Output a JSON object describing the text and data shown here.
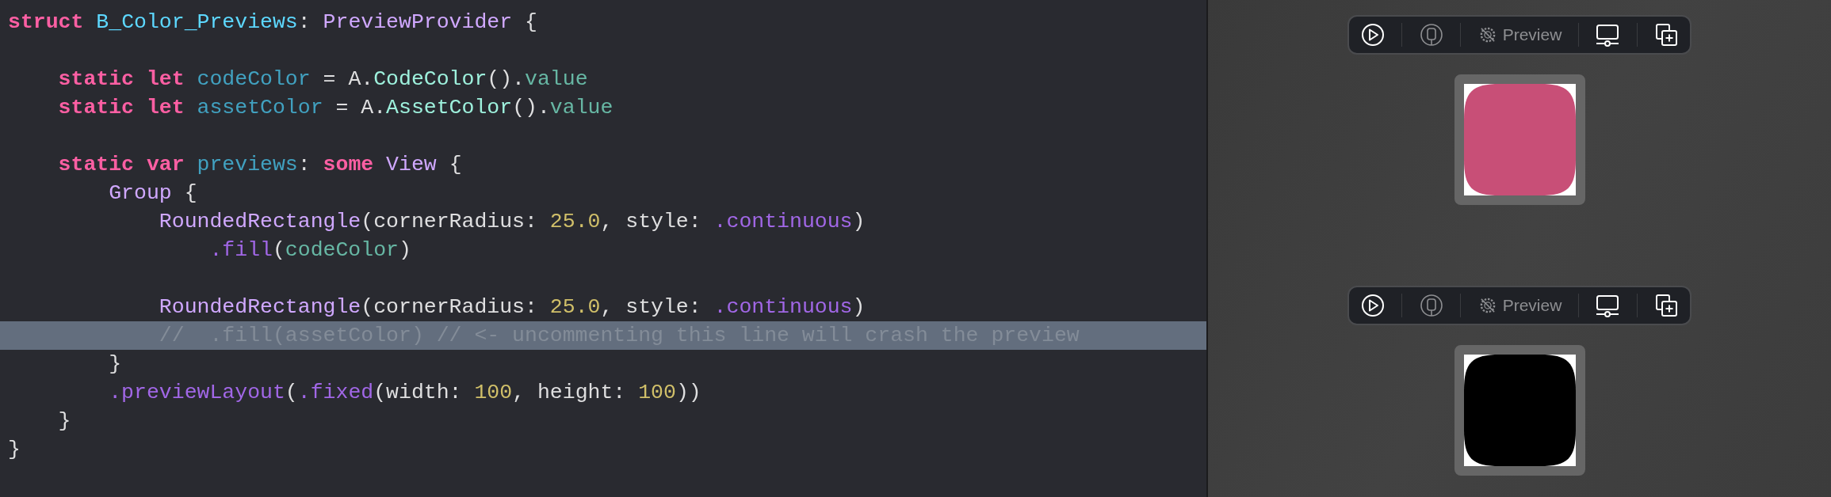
{
  "editor": {
    "lines": [
      {
        "kind": "code",
        "highlighted": false,
        "tokens": [
          {
            "kind": "keyword",
            "text": "struct "
          },
          {
            "kind": "type-decl",
            "text": "B_Color_Previews"
          },
          {
            "kind": "plain",
            "text": ": "
          },
          {
            "kind": "type",
            "text": "PreviewProvider"
          },
          {
            "kind": "plain",
            "text": " {"
          }
        ],
        "children": [
          {
            "kind": "blank",
            "highlighted": false
          },
          {
            "kind": "code",
            "highlighted": false,
            "tokens": [
              {
                "kind": "keyword",
                "text": "static let "
              },
              {
                "kind": "decl",
                "text": "codeColor"
              },
              {
                "kind": "plain",
                "text": " = A."
              },
              {
                "kind": "project-type",
                "text": "CodeColor"
              },
              {
                "kind": "plain",
                "text": "()."
              },
              {
                "kind": "project-member",
                "text": "value"
              }
            ]
          },
          {
            "kind": "code",
            "highlighted": false,
            "tokens": [
              {
                "kind": "keyword",
                "text": "static let "
              },
              {
                "kind": "decl",
                "text": "assetColor"
              },
              {
                "kind": "plain",
                "text": " = A."
              },
              {
                "kind": "project-type",
                "text": "AssetColor"
              },
              {
                "kind": "plain",
                "text": "()."
              },
              {
                "kind": "project-member",
                "text": "value"
              }
            ]
          },
          {
            "kind": "blank",
            "highlighted": false
          },
          {
            "kind": "code",
            "highlighted": false,
            "tokens": [
              {
                "kind": "keyword",
                "text": "static var "
              },
              {
                "kind": "decl",
                "text": "previews"
              },
              {
                "kind": "plain",
                "text": ": "
              },
              {
                "kind": "keyword",
                "text": "some "
              },
              {
                "kind": "type",
                "text": "View"
              },
              {
                "kind": "plain",
                "text": " {"
              }
            ],
            "children": [
              {
                "kind": "code",
                "highlighted": false,
                "tokens": [
                  {
                    "kind": "type",
                    "text": "Group"
                  },
                  {
                    "kind": "plain",
                    "text": " {"
                  }
                ],
                "children": [
                  {
                    "kind": "code",
                    "highlighted": false,
                    "tokens": [
                      {
                        "kind": "type",
                        "text": "RoundedRectangle"
                      },
                      {
                        "kind": "plain",
                        "text": "(cornerRadius: "
                      },
                      {
                        "kind": "number",
                        "text": "25.0"
                      },
                      {
                        "kind": "plain",
                        "text": ", style: "
                      },
                      {
                        "kind": "member",
                        "text": ".continuous"
                      },
                      {
                        "kind": "plain",
                        "text": ")"
                      }
                    ],
                    "children": [
                      {
                        "kind": "code",
                        "highlighted": false,
                        "tokens": [
                          {
                            "kind": "member",
                            "text": ".fill"
                          },
                          {
                            "kind": "plain",
                            "text": "("
                          },
                          {
                            "kind": "project-member",
                            "text": "codeColor"
                          },
                          {
                            "kind": "plain",
                            "text": ")"
                          }
                        ]
                      }
                    ]
                  },
                  {
                    "kind": "blank",
                    "highlighted": false
                  },
                  {
                    "kind": "code",
                    "highlighted": false,
                    "tokens": [
                      {
                        "kind": "type",
                        "text": "RoundedRectangle"
                      },
                      {
                        "kind": "plain",
                        "text": "(cornerRadius: "
                      },
                      {
                        "kind": "number",
                        "text": "25.0"
                      },
                      {
                        "kind": "plain",
                        "text": ", style: "
                      },
                      {
                        "kind": "member",
                        "text": ".continuous"
                      },
                      {
                        "kind": "plain",
                        "text": ")"
                      }
                    ]
                  },
                  {
                    "kind": "code",
                    "highlighted": true,
                    "tokens": [
                      {
                        "kind": "comment",
                        "text": "//  .fill(assetColor) // <- uncommenting this line will crash the preview"
                      }
                    ]
                  }
                ]
              },
              {
                "kind": "code",
                "highlighted": false,
                "tokens": [
                  {
                    "kind": "plain",
                    "text": "}"
                  }
                ]
              },
              {
                "kind": "code",
                "highlighted": false,
                "tokens": [
                  {
                    "kind": "member",
                    "text": ".previewLayout"
                  },
                  {
                    "kind": "plain",
                    "text": "("
                  },
                  {
                    "kind": "member",
                    "text": ".fixed"
                  },
                  {
                    "kind": "plain",
                    "text": "(width: "
                  },
                  {
                    "kind": "number",
                    "text": "100"
                  },
                  {
                    "kind": "plain",
                    "text": ", height: "
                  },
                  {
                    "kind": "number",
                    "text": "100"
                  },
                  {
                    "kind": "plain",
                    "text": "))"
                  }
                ]
              }
            ]
          },
          {
            "kind": "code",
            "highlighted": false,
            "tokens": [
              {
                "kind": "plain",
                "text": "}"
              }
            ]
          }
        ]
      },
      {
        "kind": "code",
        "highlighted": false,
        "tokens": [
          {
            "kind": "plain",
            "text": "}"
          }
        ]
      }
    ]
  },
  "previews": [
    {
      "color": "#c84f77",
      "toolbar": [
        {
          "kind": "play",
          "disabled": false
        },
        {
          "kind": "device",
          "disabled": true
        },
        {
          "kind": "mode",
          "disabled": true,
          "label": "Preview"
        },
        {
          "kind": "monitor",
          "disabled": false
        },
        {
          "kind": "duplicate",
          "disabled": false
        }
      ]
    },
    {
      "color": "#000000",
      "toolbar": [
        {
          "kind": "play",
          "disabled": false
        },
        {
          "kind": "device",
          "disabled": true
        },
        {
          "kind": "mode",
          "disabled": true,
          "label": "Preview"
        },
        {
          "kind": "monitor",
          "disabled": false
        },
        {
          "kind": "duplicate",
          "disabled": false
        }
      ]
    }
  ]
}
